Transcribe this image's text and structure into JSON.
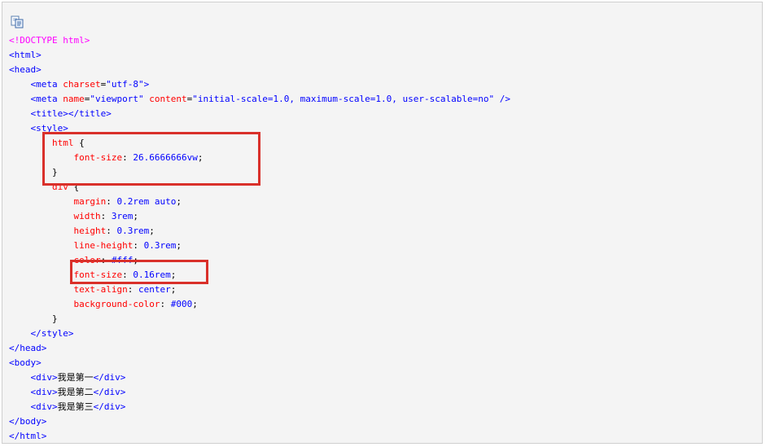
{
  "copy_icon": "copy-icon",
  "highlight_color": "#d9302a",
  "code_lines": [
    [
      {
        "c": "dt",
        "t": "<!DOCTYPE html>"
      }
    ],
    [
      {
        "c": "t",
        "t": "<html>"
      }
    ],
    [
      {
        "c": "t",
        "t": "<head>"
      }
    ],
    [
      {
        "c": "p",
        "t": "    "
      },
      {
        "c": "t",
        "t": "<meta "
      },
      {
        "c": "a",
        "t": "charset"
      },
      {
        "c": "p",
        "t": "="
      },
      {
        "c": "v",
        "t": "\"utf-8\""
      },
      {
        "c": "t",
        "t": ">"
      }
    ],
    [
      {
        "c": "p",
        "t": "    "
      },
      {
        "c": "t",
        "t": "<meta "
      },
      {
        "c": "a",
        "t": "name"
      },
      {
        "c": "p",
        "t": "="
      },
      {
        "c": "v",
        "t": "\"viewport\""
      },
      {
        "c": "p",
        "t": " "
      },
      {
        "c": "a",
        "t": "content"
      },
      {
        "c": "p",
        "t": "="
      },
      {
        "c": "v",
        "t": "\"initial-scale=1.0, maximum-scale=1.0, user-scalable=no\""
      },
      {
        "c": "p",
        "t": " "
      },
      {
        "c": "t",
        "t": "/>"
      }
    ],
    [
      {
        "c": "p",
        "t": "    "
      },
      {
        "c": "t",
        "t": "<title></title>"
      }
    ],
    [
      {
        "c": "p",
        "t": "    "
      },
      {
        "c": "t",
        "t": "<style>"
      }
    ],
    [
      {
        "c": "p",
        "t": "        "
      },
      {
        "c": "a",
        "t": "html"
      },
      {
        "c": "p",
        "t": " {"
      }
    ],
    [
      {
        "c": "p",
        "t": "            "
      },
      {
        "c": "a",
        "t": "font-size"
      },
      {
        "c": "p",
        "t": ": "
      },
      {
        "c": "v",
        "t": "26.6666666vw"
      },
      {
        "c": "p",
        "t": ";"
      }
    ],
    [
      {
        "c": "p",
        "t": "        }"
      }
    ],
    [
      {
        "c": "p",
        "t": "        "
      },
      {
        "c": "a",
        "t": "div"
      },
      {
        "c": "p",
        "t": " {"
      }
    ],
    [
      {
        "c": "p",
        "t": "            "
      },
      {
        "c": "a",
        "t": "margin"
      },
      {
        "c": "p",
        "t": ": "
      },
      {
        "c": "v",
        "t": "0.2rem auto"
      },
      {
        "c": "p",
        "t": ";"
      }
    ],
    [
      {
        "c": "p",
        "t": "            "
      },
      {
        "c": "a",
        "t": "width"
      },
      {
        "c": "p",
        "t": ": "
      },
      {
        "c": "v",
        "t": "3rem"
      },
      {
        "c": "p",
        "t": ";"
      }
    ],
    [
      {
        "c": "p",
        "t": "            "
      },
      {
        "c": "a",
        "t": "height"
      },
      {
        "c": "p",
        "t": ": "
      },
      {
        "c": "v",
        "t": "0.3rem"
      },
      {
        "c": "p",
        "t": ";"
      }
    ],
    [
      {
        "c": "p",
        "t": "            "
      },
      {
        "c": "a",
        "t": "line-height"
      },
      {
        "c": "p",
        "t": ": "
      },
      {
        "c": "v",
        "t": "0.3rem"
      },
      {
        "c": "p",
        "t": ";"
      }
    ],
    [
      {
        "c": "p",
        "t": "            "
      },
      {
        "c": "a",
        "t": "color"
      },
      {
        "c": "p",
        "t": ": "
      },
      {
        "c": "v",
        "t": "#fff"
      },
      {
        "c": "p",
        "t": ";"
      }
    ],
    [
      {
        "c": "p",
        "t": "            "
      },
      {
        "c": "a",
        "t": "font-size"
      },
      {
        "c": "p",
        "t": ": "
      },
      {
        "c": "v",
        "t": "0.16rem"
      },
      {
        "c": "p",
        "t": ";"
      }
    ],
    [
      {
        "c": "p",
        "t": "            "
      },
      {
        "c": "a",
        "t": "text-align"
      },
      {
        "c": "p",
        "t": ": "
      },
      {
        "c": "v",
        "t": "center"
      },
      {
        "c": "p",
        "t": ";"
      }
    ],
    [
      {
        "c": "p",
        "t": "            "
      },
      {
        "c": "a",
        "t": "background-color"
      },
      {
        "c": "p",
        "t": ": "
      },
      {
        "c": "v",
        "t": "#000"
      },
      {
        "c": "p",
        "t": ";"
      }
    ],
    [
      {
        "c": "p",
        "t": "        }"
      }
    ],
    [
      {
        "c": "p",
        "t": "    "
      },
      {
        "c": "t",
        "t": "</style>"
      }
    ],
    [
      {
        "c": "t",
        "t": "</head>"
      }
    ],
    [
      {
        "c": "t",
        "t": "<body>"
      }
    ],
    [
      {
        "c": "p",
        "t": "    "
      },
      {
        "c": "t",
        "t": "<div>"
      },
      {
        "c": "p",
        "t": "我是第一"
      },
      {
        "c": "t",
        "t": "</div>"
      }
    ],
    [
      {
        "c": "p",
        "t": "    "
      },
      {
        "c": "t",
        "t": "<div>"
      },
      {
        "c": "p",
        "t": "我是第二"
      },
      {
        "c": "t",
        "t": "</div>"
      }
    ],
    [
      {
        "c": "p",
        "t": "    "
      },
      {
        "c": "t",
        "t": "<div>"
      },
      {
        "c": "p",
        "t": "我是第三"
      },
      {
        "c": "t",
        "t": "</div>"
      }
    ],
    [
      {
        "c": "t",
        "t": "</body>"
      }
    ],
    [
      {
        "c": "t",
        "t": "</html>"
      }
    ]
  ]
}
